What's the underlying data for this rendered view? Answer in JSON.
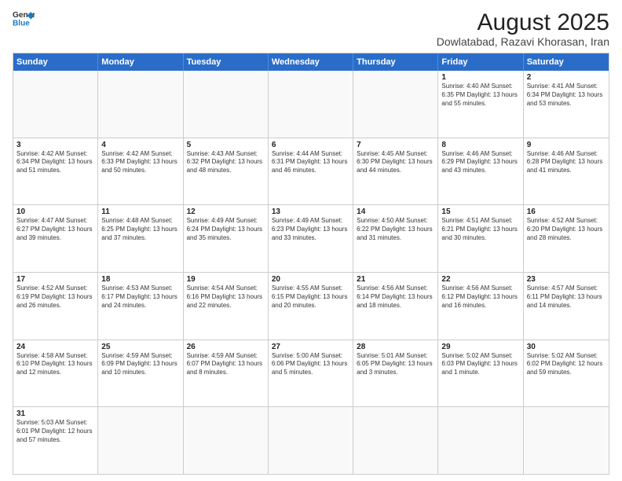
{
  "header": {
    "logo_line1": "General",
    "logo_line2": "Blue",
    "month_title": "August 2025",
    "location": "Dowlatabad, Razavi Khorasan, Iran"
  },
  "days_of_week": [
    "Sunday",
    "Monday",
    "Tuesday",
    "Wednesday",
    "Thursday",
    "Friday",
    "Saturday"
  ],
  "weeks": [
    [
      {
        "day": "",
        "info": ""
      },
      {
        "day": "",
        "info": ""
      },
      {
        "day": "",
        "info": ""
      },
      {
        "day": "",
        "info": ""
      },
      {
        "day": "",
        "info": ""
      },
      {
        "day": "1",
        "info": "Sunrise: 4:40 AM\nSunset: 6:35 PM\nDaylight: 13 hours and 55 minutes."
      },
      {
        "day": "2",
        "info": "Sunrise: 4:41 AM\nSunset: 6:34 PM\nDaylight: 13 hours and 53 minutes."
      }
    ],
    [
      {
        "day": "3",
        "info": "Sunrise: 4:42 AM\nSunset: 6:34 PM\nDaylight: 13 hours and 51 minutes."
      },
      {
        "day": "4",
        "info": "Sunrise: 4:42 AM\nSunset: 6:33 PM\nDaylight: 13 hours and 50 minutes."
      },
      {
        "day": "5",
        "info": "Sunrise: 4:43 AM\nSunset: 6:32 PM\nDaylight: 13 hours and 48 minutes."
      },
      {
        "day": "6",
        "info": "Sunrise: 4:44 AM\nSunset: 6:31 PM\nDaylight: 13 hours and 46 minutes."
      },
      {
        "day": "7",
        "info": "Sunrise: 4:45 AM\nSunset: 6:30 PM\nDaylight: 13 hours and 44 minutes."
      },
      {
        "day": "8",
        "info": "Sunrise: 4:46 AM\nSunset: 6:29 PM\nDaylight: 13 hours and 43 minutes."
      },
      {
        "day": "9",
        "info": "Sunrise: 4:46 AM\nSunset: 6:28 PM\nDaylight: 13 hours and 41 minutes."
      }
    ],
    [
      {
        "day": "10",
        "info": "Sunrise: 4:47 AM\nSunset: 6:27 PM\nDaylight: 13 hours and 39 minutes."
      },
      {
        "day": "11",
        "info": "Sunrise: 4:48 AM\nSunset: 6:25 PM\nDaylight: 13 hours and 37 minutes."
      },
      {
        "day": "12",
        "info": "Sunrise: 4:49 AM\nSunset: 6:24 PM\nDaylight: 13 hours and 35 minutes."
      },
      {
        "day": "13",
        "info": "Sunrise: 4:49 AM\nSunset: 6:23 PM\nDaylight: 13 hours and 33 minutes."
      },
      {
        "day": "14",
        "info": "Sunrise: 4:50 AM\nSunset: 6:22 PM\nDaylight: 13 hours and 31 minutes."
      },
      {
        "day": "15",
        "info": "Sunrise: 4:51 AM\nSunset: 6:21 PM\nDaylight: 13 hours and 30 minutes."
      },
      {
        "day": "16",
        "info": "Sunrise: 4:52 AM\nSunset: 6:20 PM\nDaylight: 13 hours and 28 minutes."
      }
    ],
    [
      {
        "day": "17",
        "info": "Sunrise: 4:52 AM\nSunset: 6:19 PM\nDaylight: 13 hours and 26 minutes."
      },
      {
        "day": "18",
        "info": "Sunrise: 4:53 AM\nSunset: 6:17 PM\nDaylight: 13 hours and 24 minutes."
      },
      {
        "day": "19",
        "info": "Sunrise: 4:54 AM\nSunset: 6:16 PM\nDaylight: 13 hours and 22 minutes."
      },
      {
        "day": "20",
        "info": "Sunrise: 4:55 AM\nSunset: 6:15 PM\nDaylight: 13 hours and 20 minutes."
      },
      {
        "day": "21",
        "info": "Sunrise: 4:56 AM\nSunset: 6:14 PM\nDaylight: 13 hours and 18 minutes."
      },
      {
        "day": "22",
        "info": "Sunrise: 4:56 AM\nSunset: 6:12 PM\nDaylight: 13 hours and 16 minutes."
      },
      {
        "day": "23",
        "info": "Sunrise: 4:57 AM\nSunset: 6:11 PM\nDaylight: 13 hours and 14 minutes."
      }
    ],
    [
      {
        "day": "24",
        "info": "Sunrise: 4:58 AM\nSunset: 6:10 PM\nDaylight: 13 hours and 12 minutes."
      },
      {
        "day": "25",
        "info": "Sunrise: 4:59 AM\nSunset: 6:09 PM\nDaylight: 13 hours and 10 minutes."
      },
      {
        "day": "26",
        "info": "Sunrise: 4:59 AM\nSunset: 6:07 PM\nDaylight: 13 hours and 8 minutes."
      },
      {
        "day": "27",
        "info": "Sunrise: 5:00 AM\nSunset: 6:06 PM\nDaylight: 13 hours and 5 minutes."
      },
      {
        "day": "28",
        "info": "Sunrise: 5:01 AM\nSunset: 6:05 PM\nDaylight: 13 hours and 3 minutes."
      },
      {
        "day": "29",
        "info": "Sunrise: 5:02 AM\nSunset: 6:03 PM\nDaylight: 13 hours and 1 minute."
      },
      {
        "day": "30",
        "info": "Sunrise: 5:02 AM\nSunset: 6:02 PM\nDaylight: 12 hours and 59 minutes."
      }
    ],
    [
      {
        "day": "31",
        "info": "Sunrise: 5:03 AM\nSunset: 6:01 PM\nDaylight: 12 hours and 57 minutes."
      },
      {
        "day": "",
        "info": ""
      },
      {
        "day": "",
        "info": ""
      },
      {
        "day": "",
        "info": ""
      },
      {
        "day": "",
        "info": ""
      },
      {
        "day": "",
        "info": ""
      },
      {
        "day": "",
        "info": ""
      }
    ]
  ]
}
